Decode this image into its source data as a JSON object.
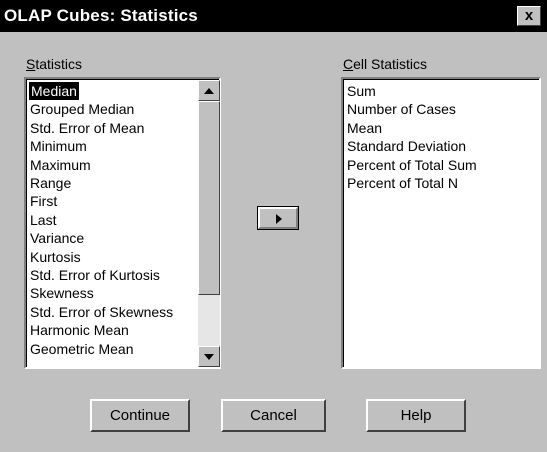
{
  "window": {
    "title": "OLAP Cubes: Statistics",
    "close_glyph": "x"
  },
  "statistics": {
    "label": "Statistics",
    "items": [
      "Median",
      "Grouped Median",
      "Std. Error of Mean",
      "Minimum",
      "Maximum",
      "Range",
      "First",
      "Last",
      "Variance",
      "Kurtosis",
      "Std. Error of Kurtosis",
      "Skewness",
      "Std. Error of Skewness",
      "Harmonic Mean",
      "Geometric Mean"
    ],
    "selected": "Median"
  },
  "cell_statistics": {
    "label": "Cell Statistics",
    "items": [
      "Sum",
      "Number of Cases",
      "Mean",
      "Standard Deviation",
      "Percent of Total Sum",
      "Percent of Total N"
    ]
  },
  "buttons": {
    "continue": "Continue",
    "cancel": "Cancel",
    "help": "Help"
  },
  "icons": {
    "move_right": "right-arrow-icon",
    "scroll_up": "up-arrow-icon",
    "scroll_down": "down-arrow-icon"
  }
}
